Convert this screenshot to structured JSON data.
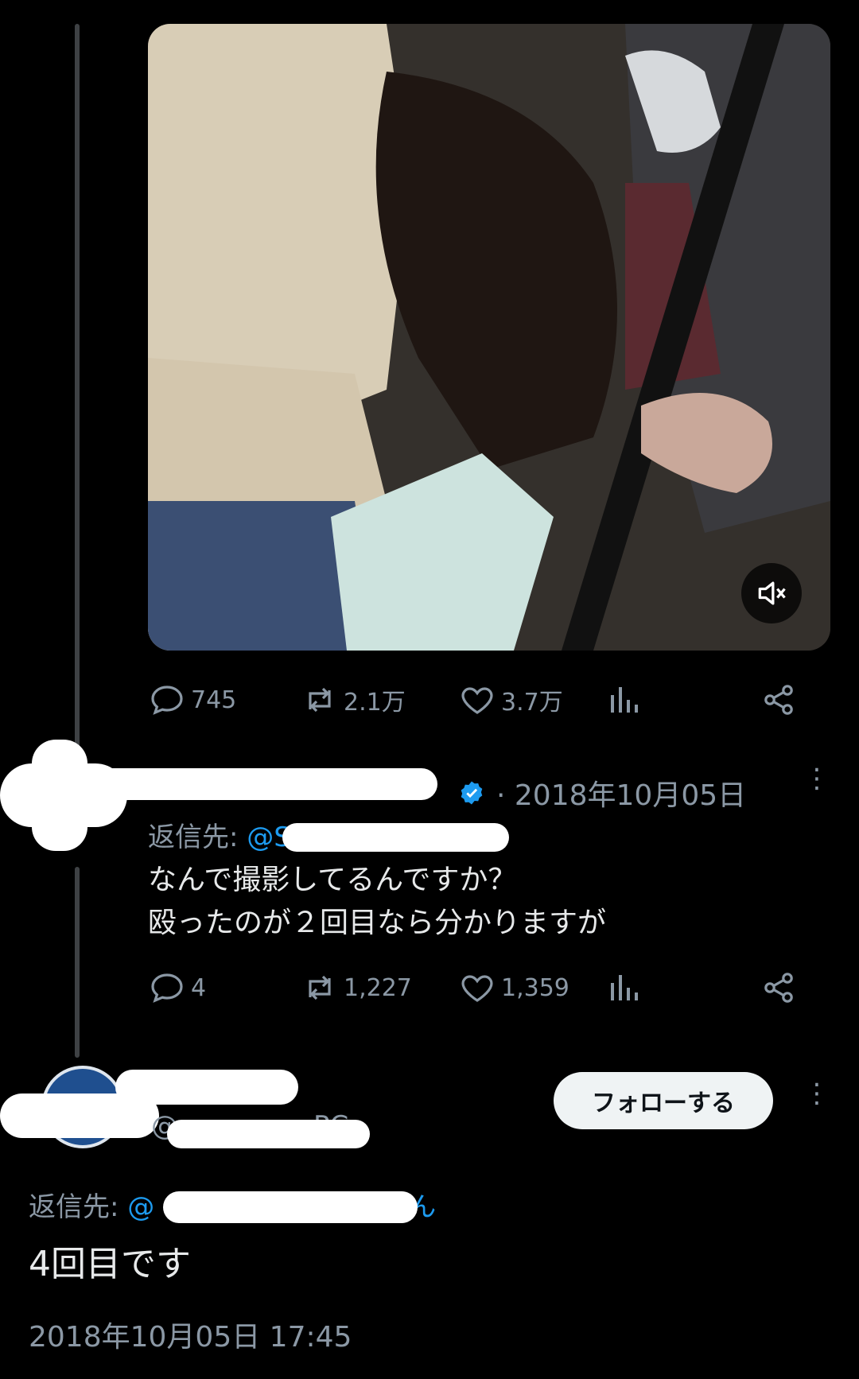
{
  "video": {
    "mute_icon": "speaker-muted-icon"
  },
  "main_tweet": {
    "stats": {
      "replies": "745",
      "retweets": "2.1万",
      "likes": "3.7万"
    }
  },
  "reply1": {
    "date": "· 2018年10月05日",
    "reply_to_label": "返信先: ",
    "reply_to_handle": "@S",
    "text_line1": "なんで撮影してるんですか？",
    "text_line2": "殴ったのが２回目なら分かりますが",
    "stats": {
      "replies": "4",
      "retweets": "1,227",
      "likes": "1,359"
    }
  },
  "reply2": {
    "handle_partial": "@",
    "handle_suffix": "PC",
    "follow_label": "フォローする",
    "reply_to_label": "返信先: ",
    "reply_to_handle": "@",
    "reply_to_suffix": "さん",
    "text": "4回目です",
    "timestamp": "2018年10月05日 17:45"
  },
  "colors": {
    "link": "#1d9bf0",
    "muted": "#8b98a5",
    "text": "#e7e9ea",
    "verified": "#1d9bf0"
  }
}
